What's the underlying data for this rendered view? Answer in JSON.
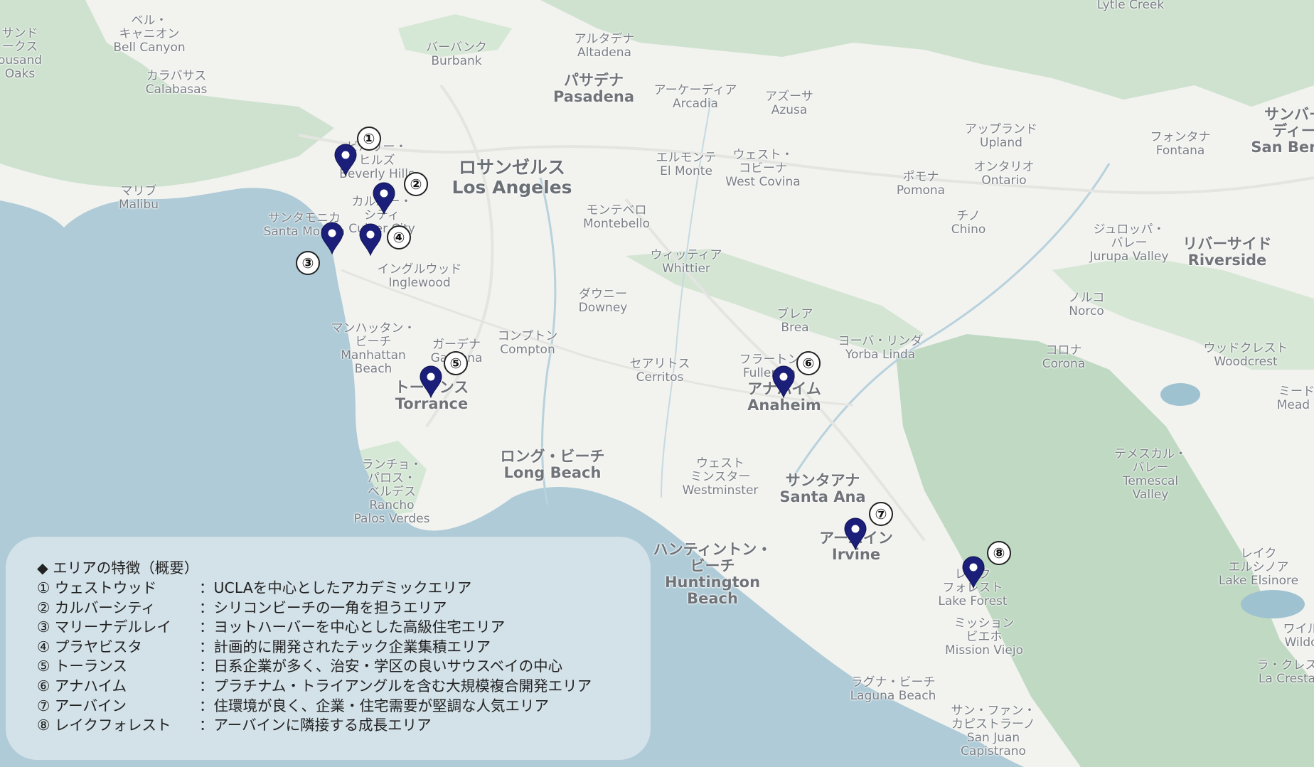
{
  "colors": {
    "water": "#aecbd7",
    "land": "#f2f2ef",
    "park": "#c9dfca",
    "mountain": "#b9d6bd",
    "pin": "#1b1f7a"
  },
  "place_labels": [
    {
      "id": "santa-clarita-area",
      "lines": [
        "サンド",
        "ークス",
        "ousand",
        "Oaks"
      ]
    },
    {
      "id": "bell-canyon",
      "lines": [
        "ベル・",
        "キャニオン",
        "Bell Canyon"
      ]
    },
    {
      "id": "calabasas",
      "lines": [
        "カラバサス",
        "Calabasas"
      ]
    },
    {
      "id": "burbank",
      "lines": [
        "バーバンク",
        "Burbank"
      ]
    },
    {
      "id": "altadena",
      "lines": [
        "アルタデナ",
        "Altadena"
      ]
    },
    {
      "id": "pasadena",
      "lines": [
        "パサデナ",
        "Pasadena"
      ]
    },
    {
      "id": "arcadia",
      "lines": [
        "アーケーディア",
        "Arcadia"
      ]
    },
    {
      "id": "azusa",
      "lines": [
        "アズーサ",
        "Azusa"
      ]
    },
    {
      "id": "lytle-creek",
      "lines": [
        "Lytle Creek"
      ]
    },
    {
      "id": "upland",
      "lines": [
        "アップランド",
        "Upland"
      ]
    },
    {
      "id": "fontana",
      "lines": [
        "フォンタナ",
        "Fontana"
      ]
    },
    {
      "id": "san-bernardino",
      "lines": [
        "サンバー",
        "ディー",
        "San Berna"
      ]
    },
    {
      "id": "ontario",
      "lines": [
        "オンタリオ",
        "Ontario"
      ]
    },
    {
      "id": "el-monte",
      "lines": [
        "エルモンテ",
        "El Monte"
      ]
    },
    {
      "id": "west-covina",
      "lines": [
        "ウェスト・",
        "コビーナ",
        "West Covina"
      ]
    },
    {
      "id": "pomona",
      "lines": [
        "ポモナ",
        "Pomona"
      ]
    },
    {
      "id": "beverly-hills",
      "lines": [
        "ビバリー・",
        "ヒルズ",
        "Beverly Hills"
      ]
    },
    {
      "id": "los-angeles",
      "lines": [
        "ロサンゼルス",
        "Los Angeles"
      ]
    },
    {
      "id": "malibu",
      "lines": [
        "マリブ",
        "Malibu"
      ]
    },
    {
      "id": "culver-city",
      "lines": [
        "カルバー・",
        "シティ",
        "Culver City"
      ]
    },
    {
      "id": "santa-monica",
      "lines": [
        "サンタモニカ",
        "Santa Monica"
      ]
    },
    {
      "id": "montebello",
      "lines": [
        "モンテベロ",
        "Montebello"
      ]
    },
    {
      "id": "chino",
      "lines": [
        "チノ",
        "Chino"
      ]
    },
    {
      "id": "jurupa-valley",
      "lines": [
        "ジュロッパ・",
        "バレー",
        "Jurupa Valley"
      ]
    },
    {
      "id": "riverside",
      "lines": [
        "リバーサイド",
        "Riverside"
      ]
    },
    {
      "id": "inglewood",
      "lines": [
        "イングルウッド",
        "Inglewood"
      ]
    },
    {
      "id": "whittier",
      "lines": [
        "ウィッティア",
        "Whittier"
      ]
    },
    {
      "id": "downey",
      "lines": [
        "ダウニー",
        "Downey"
      ]
    },
    {
      "id": "norco",
      "lines": [
        "ノルコ",
        "Norco"
      ]
    },
    {
      "id": "brea",
      "lines": [
        "ブレア",
        "Brea"
      ]
    },
    {
      "id": "manhattan-beach",
      "lines": [
        "マンハッタン・",
        "ビーチ",
        "Manhattan",
        "Beach"
      ]
    },
    {
      "id": "compton",
      "lines": [
        "コンプトン",
        "Compton"
      ]
    },
    {
      "id": "gardena",
      "lines": [
        "ガーデナ",
        "Gardena"
      ]
    },
    {
      "id": "yorba-linda",
      "lines": [
        "ヨーバ・リンダ",
        "Yorba Linda"
      ]
    },
    {
      "id": "corona",
      "lines": [
        "コロナ",
        "Corona"
      ]
    },
    {
      "id": "woodcrest",
      "lines": [
        "ウッドクレスト",
        "Woodcrest"
      ]
    },
    {
      "id": "cerritos",
      "lines": [
        "セアリトス",
        "Cerritos"
      ]
    },
    {
      "id": "fullerton",
      "lines": [
        "フラートン",
        "Fullerton"
      ]
    },
    {
      "id": "torrance",
      "lines": [
        "トーランス",
        "Torrance"
      ]
    },
    {
      "id": "anaheim",
      "lines": [
        "アナハイム",
        "Anaheim"
      ]
    },
    {
      "id": "mead-valley",
      "lines": [
        "ミード・",
        "Mead Va"
      ]
    },
    {
      "id": "rancho-palos-verdes",
      "lines": [
        "ランチョ・",
        "パロス・",
        "ベルデス",
        "Rancho",
        "Palos Verdes"
      ]
    },
    {
      "id": "long-beach",
      "lines": [
        "ロング・ビーチ",
        "Long Beach"
      ]
    },
    {
      "id": "westminster",
      "lines": [
        "ウェスト",
        "ミンスター",
        "Westminster"
      ]
    },
    {
      "id": "santa-ana",
      "lines": [
        "サンタアナ",
        "Santa Ana"
      ]
    },
    {
      "id": "temescal-valley",
      "lines": [
        "テメスカル・",
        "バレー",
        "Temescal",
        "Valley"
      ]
    },
    {
      "id": "huntington-beach",
      "lines": [
        "ハンティントン・",
        "ビーチ",
        "Huntington",
        "Beach"
      ]
    },
    {
      "id": "irvine",
      "lines": [
        "アーバイン",
        "Irvine"
      ]
    },
    {
      "id": "lake-elsinore",
      "lines": [
        "レイク",
        "エルシノア",
        "Lake Elsinore"
      ]
    },
    {
      "id": "lake-forest",
      "lines": [
        "レイク",
        "フォレスト",
        "Lake Forest"
      ]
    },
    {
      "id": "wildomar",
      "lines": [
        "ワイル",
        "Wildo"
      ]
    },
    {
      "id": "mission-viejo",
      "lines": [
        "ミッション",
        "ビエホ",
        "Mission Viejo"
      ]
    },
    {
      "id": "la-cresta",
      "lines": [
        "ラ・クレス",
        "La Cresta"
      ]
    },
    {
      "id": "laguna-beach",
      "lines": [
        "ラグナ・ビーチ",
        "Laguna Beach"
      ]
    },
    {
      "id": "san-juan-capistrano",
      "lines": [
        "サン・ファン・",
        "カピストラーノ",
        "San Juan",
        "Capistrano"
      ]
    }
  ],
  "markers": [
    "①",
    "②",
    "③",
    "④",
    "⑤",
    "⑥",
    "⑦",
    "⑧"
  ],
  "legend": {
    "title": "◆ エリアの特徴（概要）",
    "rows": [
      {
        "name": "① ウェストウッド",
        "desc": "：UCLAを中心としたアカデミックエリア"
      },
      {
        "name": "② カルバーシティ",
        "desc": "：シリコンビーチの一角を担うエリア"
      },
      {
        "name": "③ マリーナデルレイ",
        "desc": "：ヨットハーバーを中心とした高級住宅エリア"
      },
      {
        "name": "④ プラヤビスタ",
        "desc": "：計画的に開発されたテック企業集積エリア"
      },
      {
        "name": "⑤ トーランス",
        "desc": "：日系企業が多く、治安・学区の良いサウスベイの中心"
      },
      {
        "name": "⑥ アナハイム",
        "desc": "：プラチナム・トライアングルを含む大規模複合開発エリア"
      },
      {
        "name": "⑦ アーバイン",
        "desc": "：住環境が良く、企業・住宅需要が堅調な人気エリア"
      },
      {
        "name": "⑧ レイクフォレスト",
        "desc": "：アーバインに隣接する成長エリア"
      }
    ]
  }
}
